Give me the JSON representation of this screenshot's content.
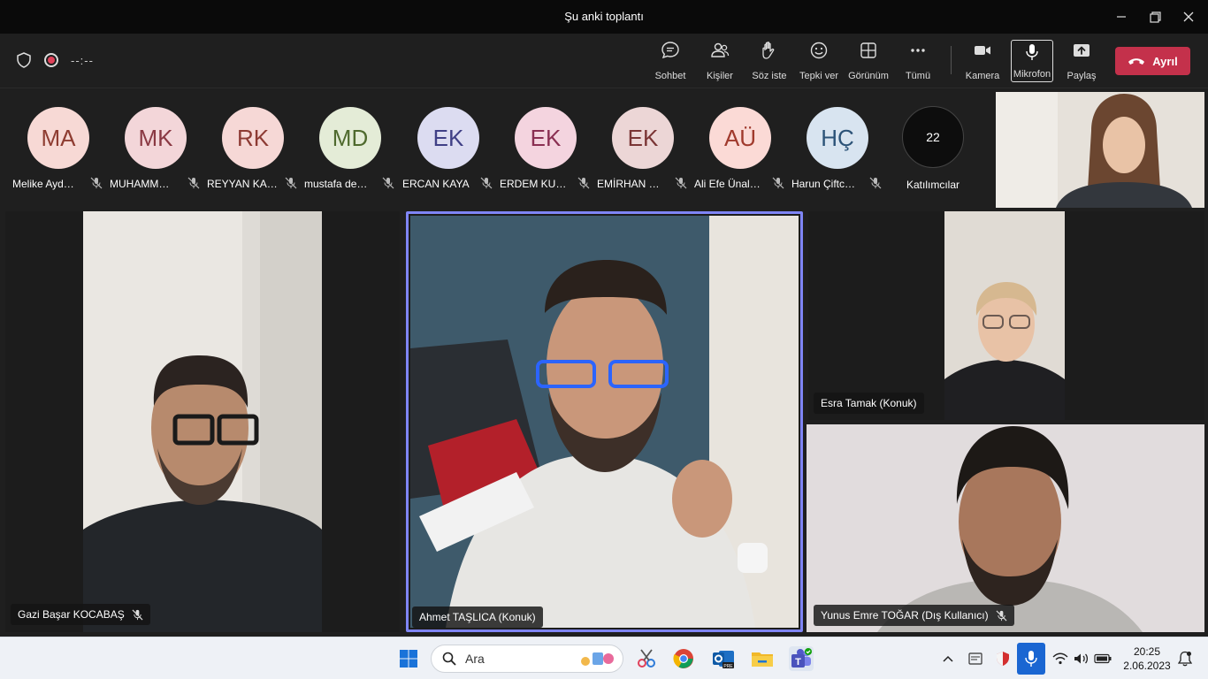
{
  "window": {
    "title": "Şu anki toplantı"
  },
  "toolbar": {
    "timer": "--:--",
    "buttons": [
      {
        "label": "Sohbet",
        "icon": "chat-icon"
      },
      {
        "label": "Kişiler",
        "icon": "people-icon"
      },
      {
        "label": "Söz iste",
        "icon": "raise-hand-icon"
      },
      {
        "label": "Tepki ver",
        "icon": "emoji-icon"
      },
      {
        "label": "Görünüm",
        "icon": "grid-view-icon"
      },
      {
        "label": "Tümü",
        "icon": "more-icon"
      },
      {
        "label": "Kamera",
        "icon": "camera-icon"
      },
      {
        "label": "Mikrofon",
        "icon": "microphone-icon"
      },
      {
        "label": "Paylaş",
        "icon": "share-icon"
      }
    ],
    "leave_label": "Ayrıl"
  },
  "participants": [
    {
      "initials": "MA",
      "name": "Melike Ayd…",
      "bg": "#f7d9d5",
      "fg": "#8e3c31"
    },
    {
      "initials": "MK",
      "name": "MUHAMM…",
      "bg": "#f3d6d9",
      "fg": "#8a3943"
    },
    {
      "initials": "RK",
      "name": "REYYAN KA…",
      "bg": "#f6d8d6",
      "fg": "#8d3a33"
    },
    {
      "initials": "MD",
      "name": "mustafa de…",
      "bg": "#e4ecd7",
      "fg": "#4f6a2e"
    },
    {
      "initials": "EK",
      "name": "ERCAN KAYA",
      "bg": "#dcdcf1",
      "fg": "#3f3f86"
    },
    {
      "initials": "EK",
      "name": "ERDEM KU…",
      "bg": "#f4d4df",
      "fg": "#8a2f52"
    },
    {
      "initials": "EK",
      "name": "EMİRHAN …",
      "bg": "#ecd6d6",
      "fg": "#7a3535"
    },
    {
      "initials": "AÜ",
      "name": "Ali Efe Ünal…",
      "bg": "#fbdad6",
      "fg": "#a03a2d"
    },
    {
      "initials": "HÇ",
      "name": "Harun Çiftc…",
      "bg": "#d8e4f0",
      "fg": "#2c5378"
    }
  ],
  "participants_count": {
    "value": "22",
    "label": "Katılımcılar"
  },
  "videos": [
    {
      "name": "Gazi Başar KOCABAŞ",
      "muted": true
    },
    {
      "name": "Ahmet TAŞLICA (Konuk)",
      "muted": false
    },
    {
      "name": "Esra Tamak (Konuk)",
      "muted": false
    },
    {
      "name": "Yunus Emre TOĞAR (Dış Kullanıcı)",
      "muted": true
    }
  ],
  "taskbar": {
    "search_placeholder": "Ara",
    "time": "20:25",
    "date": "2.06.2023"
  }
}
